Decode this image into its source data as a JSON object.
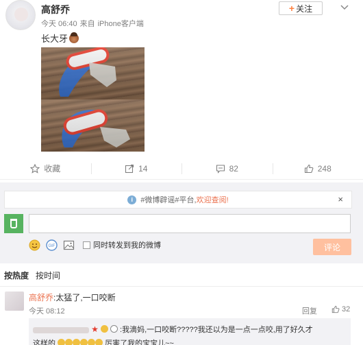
{
  "post": {
    "username": "高舒乔",
    "time": "今天 06:40",
    "source_prefix": "来自",
    "source": "iPhone客户端",
    "text": "长大牙",
    "follow_label": "关注"
  },
  "actions": {
    "favorite_label": "收藏",
    "repost_count": "14",
    "comment_count": "82",
    "like_count": "248"
  },
  "comments_panel": {
    "notice_prefix": "#微博辟谣#平台,",
    "notice_link": "欢迎查阅!",
    "forward_checkbox_label": "同时转发到我的微博",
    "submit_label": "评论"
  },
  "sort_tabs": [
    "按热度",
    "按时间"
  ],
  "comment": {
    "author": "高舒乔",
    "text": ":太猛了,一口咬断",
    "time": "今天 08:12",
    "reply_label": "回复",
    "like_count": "32",
    "sub_line1": ":我滴妈,一口咬断?????我还以为是一点一点咬,用了好久才",
    "sub_line2_prefix": "这样的",
    "sub_line2_suffix": "厉害了我的宝宝儿~~"
  },
  "colors": {
    "accent": "#eb7350",
    "follow_plus": "#ff8140",
    "submit_disabled": "#ffc09f",
    "panel_bg": "#f2f2f5",
    "my_avatar": "#57b360"
  }
}
